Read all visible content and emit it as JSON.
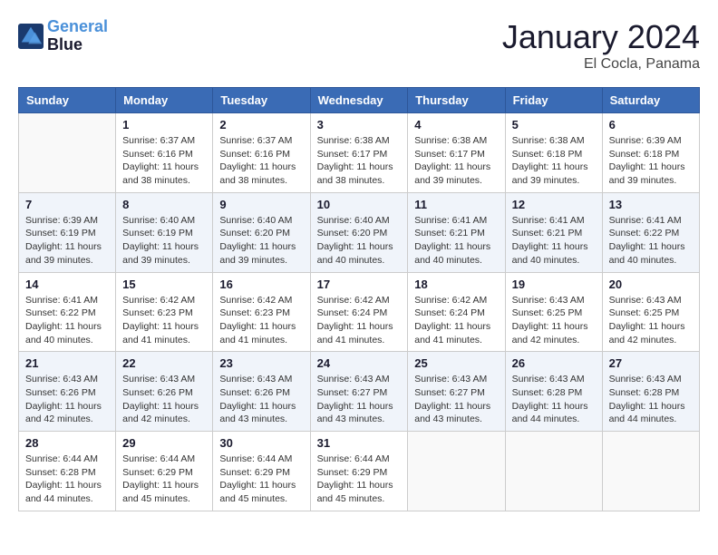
{
  "header": {
    "logo_line1": "General",
    "logo_line2": "Blue",
    "month_title": "January 2024",
    "location": "El Cocla, Panama"
  },
  "days_of_week": [
    "Sunday",
    "Monday",
    "Tuesday",
    "Wednesday",
    "Thursday",
    "Friday",
    "Saturday"
  ],
  "weeks": [
    [
      {
        "day": "",
        "info": ""
      },
      {
        "day": "1",
        "info": "Sunrise: 6:37 AM\nSunset: 6:16 PM\nDaylight: 11 hours\nand 38 minutes."
      },
      {
        "day": "2",
        "info": "Sunrise: 6:37 AM\nSunset: 6:16 PM\nDaylight: 11 hours\nand 38 minutes."
      },
      {
        "day": "3",
        "info": "Sunrise: 6:38 AM\nSunset: 6:17 PM\nDaylight: 11 hours\nand 38 minutes."
      },
      {
        "day": "4",
        "info": "Sunrise: 6:38 AM\nSunset: 6:17 PM\nDaylight: 11 hours\nand 39 minutes."
      },
      {
        "day": "5",
        "info": "Sunrise: 6:38 AM\nSunset: 6:18 PM\nDaylight: 11 hours\nand 39 minutes."
      },
      {
        "day": "6",
        "info": "Sunrise: 6:39 AM\nSunset: 6:18 PM\nDaylight: 11 hours\nand 39 minutes."
      }
    ],
    [
      {
        "day": "7",
        "info": "Sunrise: 6:39 AM\nSunset: 6:19 PM\nDaylight: 11 hours\nand 39 minutes."
      },
      {
        "day": "8",
        "info": "Sunrise: 6:40 AM\nSunset: 6:19 PM\nDaylight: 11 hours\nand 39 minutes."
      },
      {
        "day": "9",
        "info": "Sunrise: 6:40 AM\nSunset: 6:20 PM\nDaylight: 11 hours\nand 39 minutes."
      },
      {
        "day": "10",
        "info": "Sunrise: 6:40 AM\nSunset: 6:20 PM\nDaylight: 11 hours\nand 40 minutes."
      },
      {
        "day": "11",
        "info": "Sunrise: 6:41 AM\nSunset: 6:21 PM\nDaylight: 11 hours\nand 40 minutes."
      },
      {
        "day": "12",
        "info": "Sunrise: 6:41 AM\nSunset: 6:21 PM\nDaylight: 11 hours\nand 40 minutes."
      },
      {
        "day": "13",
        "info": "Sunrise: 6:41 AM\nSunset: 6:22 PM\nDaylight: 11 hours\nand 40 minutes."
      }
    ],
    [
      {
        "day": "14",
        "info": "Sunrise: 6:41 AM\nSunset: 6:22 PM\nDaylight: 11 hours\nand 40 minutes."
      },
      {
        "day": "15",
        "info": "Sunrise: 6:42 AM\nSunset: 6:23 PM\nDaylight: 11 hours\nand 41 minutes."
      },
      {
        "day": "16",
        "info": "Sunrise: 6:42 AM\nSunset: 6:23 PM\nDaylight: 11 hours\nand 41 minutes."
      },
      {
        "day": "17",
        "info": "Sunrise: 6:42 AM\nSunset: 6:24 PM\nDaylight: 11 hours\nand 41 minutes."
      },
      {
        "day": "18",
        "info": "Sunrise: 6:42 AM\nSunset: 6:24 PM\nDaylight: 11 hours\nand 41 minutes."
      },
      {
        "day": "19",
        "info": "Sunrise: 6:43 AM\nSunset: 6:25 PM\nDaylight: 11 hours\nand 42 minutes."
      },
      {
        "day": "20",
        "info": "Sunrise: 6:43 AM\nSunset: 6:25 PM\nDaylight: 11 hours\nand 42 minutes."
      }
    ],
    [
      {
        "day": "21",
        "info": "Sunrise: 6:43 AM\nSunset: 6:26 PM\nDaylight: 11 hours\nand 42 minutes."
      },
      {
        "day": "22",
        "info": "Sunrise: 6:43 AM\nSunset: 6:26 PM\nDaylight: 11 hours\nand 42 minutes."
      },
      {
        "day": "23",
        "info": "Sunrise: 6:43 AM\nSunset: 6:26 PM\nDaylight: 11 hours\nand 43 minutes."
      },
      {
        "day": "24",
        "info": "Sunrise: 6:43 AM\nSunset: 6:27 PM\nDaylight: 11 hours\nand 43 minutes."
      },
      {
        "day": "25",
        "info": "Sunrise: 6:43 AM\nSunset: 6:27 PM\nDaylight: 11 hours\nand 43 minutes."
      },
      {
        "day": "26",
        "info": "Sunrise: 6:43 AM\nSunset: 6:28 PM\nDaylight: 11 hours\nand 44 minutes."
      },
      {
        "day": "27",
        "info": "Sunrise: 6:43 AM\nSunset: 6:28 PM\nDaylight: 11 hours\nand 44 minutes."
      }
    ],
    [
      {
        "day": "28",
        "info": "Sunrise: 6:44 AM\nSunset: 6:28 PM\nDaylight: 11 hours\nand 44 minutes."
      },
      {
        "day": "29",
        "info": "Sunrise: 6:44 AM\nSunset: 6:29 PM\nDaylight: 11 hours\nand 45 minutes."
      },
      {
        "day": "30",
        "info": "Sunrise: 6:44 AM\nSunset: 6:29 PM\nDaylight: 11 hours\nand 45 minutes."
      },
      {
        "day": "31",
        "info": "Sunrise: 6:44 AM\nSunset: 6:29 PM\nDaylight: 11 hours\nand 45 minutes."
      },
      {
        "day": "",
        "info": ""
      },
      {
        "day": "",
        "info": ""
      },
      {
        "day": "",
        "info": ""
      }
    ]
  ]
}
